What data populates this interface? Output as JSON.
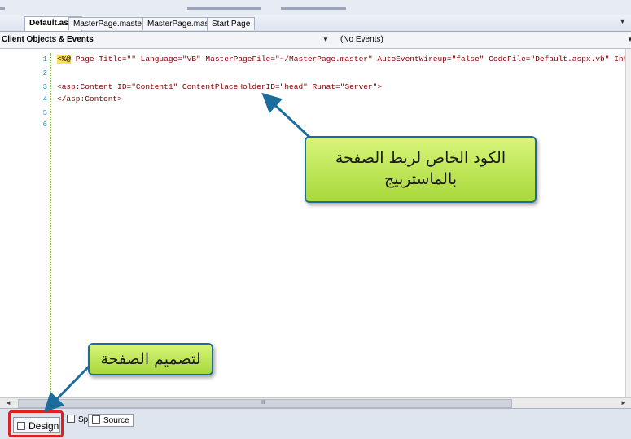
{
  "tabs": [
    {
      "label": "Default.aspx",
      "active": true
    },
    {
      "label": "MasterPage.master.vb*",
      "active": false
    },
    {
      "label": "MasterPage.master*",
      "active": false
    },
    {
      "label": "Start Page",
      "active": false
    }
  ],
  "tab_dropdown_icon": "chevron-down-icon",
  "selectors": {
    "objects": "Client Objects & Events",
    "events": "(No Events)"
  },
  "editor": {
    "line_numbers": [
      "1",
      "2",
      "3",
      "4",
      "5",
      "6"
    ],
    "lines": {
      "l1_prefix": "<%@",
      "l1_rest": " Page Title=\"\" Language=\"VB\" MasterPageFile=\"~/MasterPage.master\" AutoEventWireup=\"false\" CodeFile=\"Default.aspx.vb\" Inherits=\"",
      "l3": "<asp:Content ID=\"Content1\" ContentPlaceHolderID=\"head\" Runat=\"Server\">",
      "l4": "</asp:Content>"
    }
  },
  "view_buttons": {
    "design": "Design",
    "split": "Split",
    "source": "Source"
  },
  "scrollbar_grip": "III",
  "annotations": {
    "master_link": "الكود الخاص لربط الصفحة بالماستربيج",
    "design_view": "لتصميم الصفحة"
  },
  "colors": {
    "callout_fill": "#b9e34f",
    "callout_border": "#1d6d9c",
    "design_highlight": "#e02020",
    "arrow": "#1d6d9c"
  }
}
